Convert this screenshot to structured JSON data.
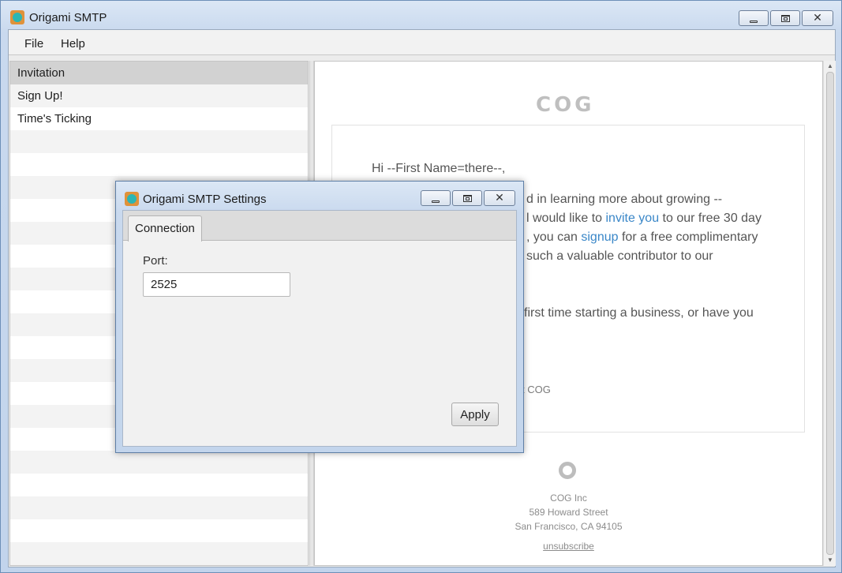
{
  "window": {
    "title": "Origami SMTP",
    "minimize_glyph": "",
    "close_glyph": "✕"
  },
  "menu": [
    "File",
    "Help"
  ],
  "templates": {
    "items": [
      "Invitation",
      "Sign Up!",
      "Time's Ticking"
    ],
    "selected": "Invitation"
  },
  "preview": {
    "logo": "COG",
    "greeting": "Hi --First Name=there--,",
    "line1": "d in learning more about growing --",
    "line2_pre": "l would like to ",
    "line2_link": "invite you",
    "line2_post": " to our free 30 day",
    "line3_pre": ", you can ",
    "line3_link": "signup",
    "line3_post": " for a free complimentary",
    "line4": " such a valuable contributor to our",
    "line5": "first time starting a business, or have you",
    "signature": "t COG",
    "footer": {
      "company": "COG Inc",
      "street": "589 Howard Street",
      "city": "San Francisco, CA 94105",
      "unsubscribe": "unsubscribe"
    }
  },
  "dialog": {
    "title": "Origami SMTP Settings",
    "tab": "Connection",
    "port_label": "Port:",
    "port_value": "2525",
    "apply_label": "Apply"
  },
  "colors": {
    "link": "#3a87c8",
    "selected_row": "#d2d2d2",
    "app_icon_outer": "#e0923a",
    "app_icon_inner": "#2bb6b4"
  }
}
